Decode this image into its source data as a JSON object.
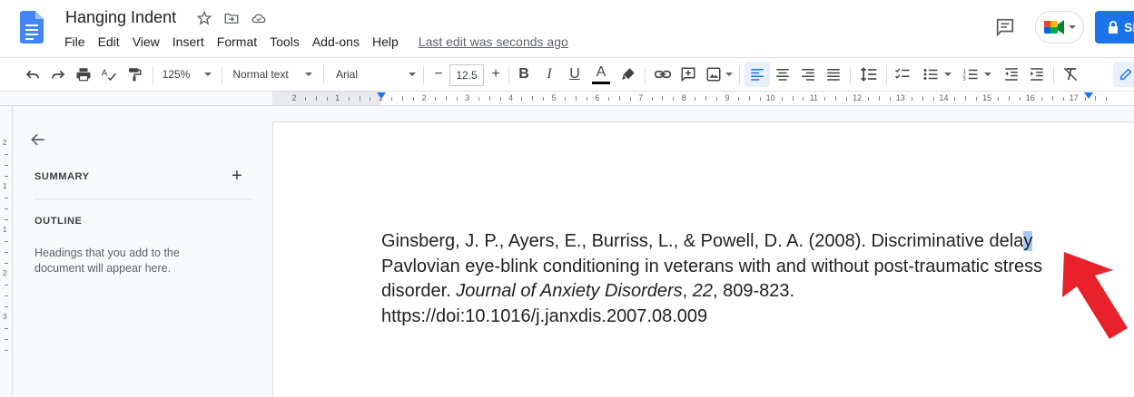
{
  "header": {
    "title": "Hanging Indent",
    "last_edit": "Last edit was seconds ago",
    "share_label": "Sh"
  },
  "menu": [
    "File",
    "Edit",
    "View",
    "Insert",
    "Format",
    "Tools",
    "Add-ons",
    "Help"
  ],
  "toolbar": {
    "zoom": "125%",
    "style": "Normal text",
    "font": "Arial",
    "font_size": "12.5",
    "minus": "−",
    "plus": "+",
    "bold": "B",
    "italic": "I",
    "underline": "U",
    "text_color_letter": "A"
  },
  "ruler": {
    "numbers": [
      "2",
      "1",
      "1",
      "2",
      "3",
      "4",
      "5",
      "6",
      "7",
      "8",
      "9",
      "10",
      "11",
      "12",
      "13",
      "14",
      "15",
      "16",
      "17"
    ]
  },
  "vruler": {
    "numbers": [
      "2",
      "1",
      "1",
      "2",
      "3"
    ]
  },
  "sidebar": {
    "summary_label": "SUMMARY",
    "add_label": "+",
    "outline_label": "OUTLINE",
    "outline_hint": "Headings that you add to the document will appear here."
  },
  "document": {
    "line1_before": "Ginsberg, J. P., Ayers, E., Burriss, L., & Powell, D. A. (2008). Discriminative dela",
    "line1_selected": "y",
    "line2": "Pavlovian eye-blink conditioning in veterans with and without post-traumatic stress",
    "line3_before": "disorder. ",
    "line3_journal": "Journal of Anxiety Disorders",
    "line3_comma": ", ",
    "line3_volume": "22",
    "line3_pages": ", 809-823.",
    "line4": "https://doi:10.1016/j.janxdis.2007.08.009"
  },
  "colors": {
    "accent": "#1a73e8",
    "selection": "#a9c8f5",
    "arrow": "#e8212a"
  }
}
